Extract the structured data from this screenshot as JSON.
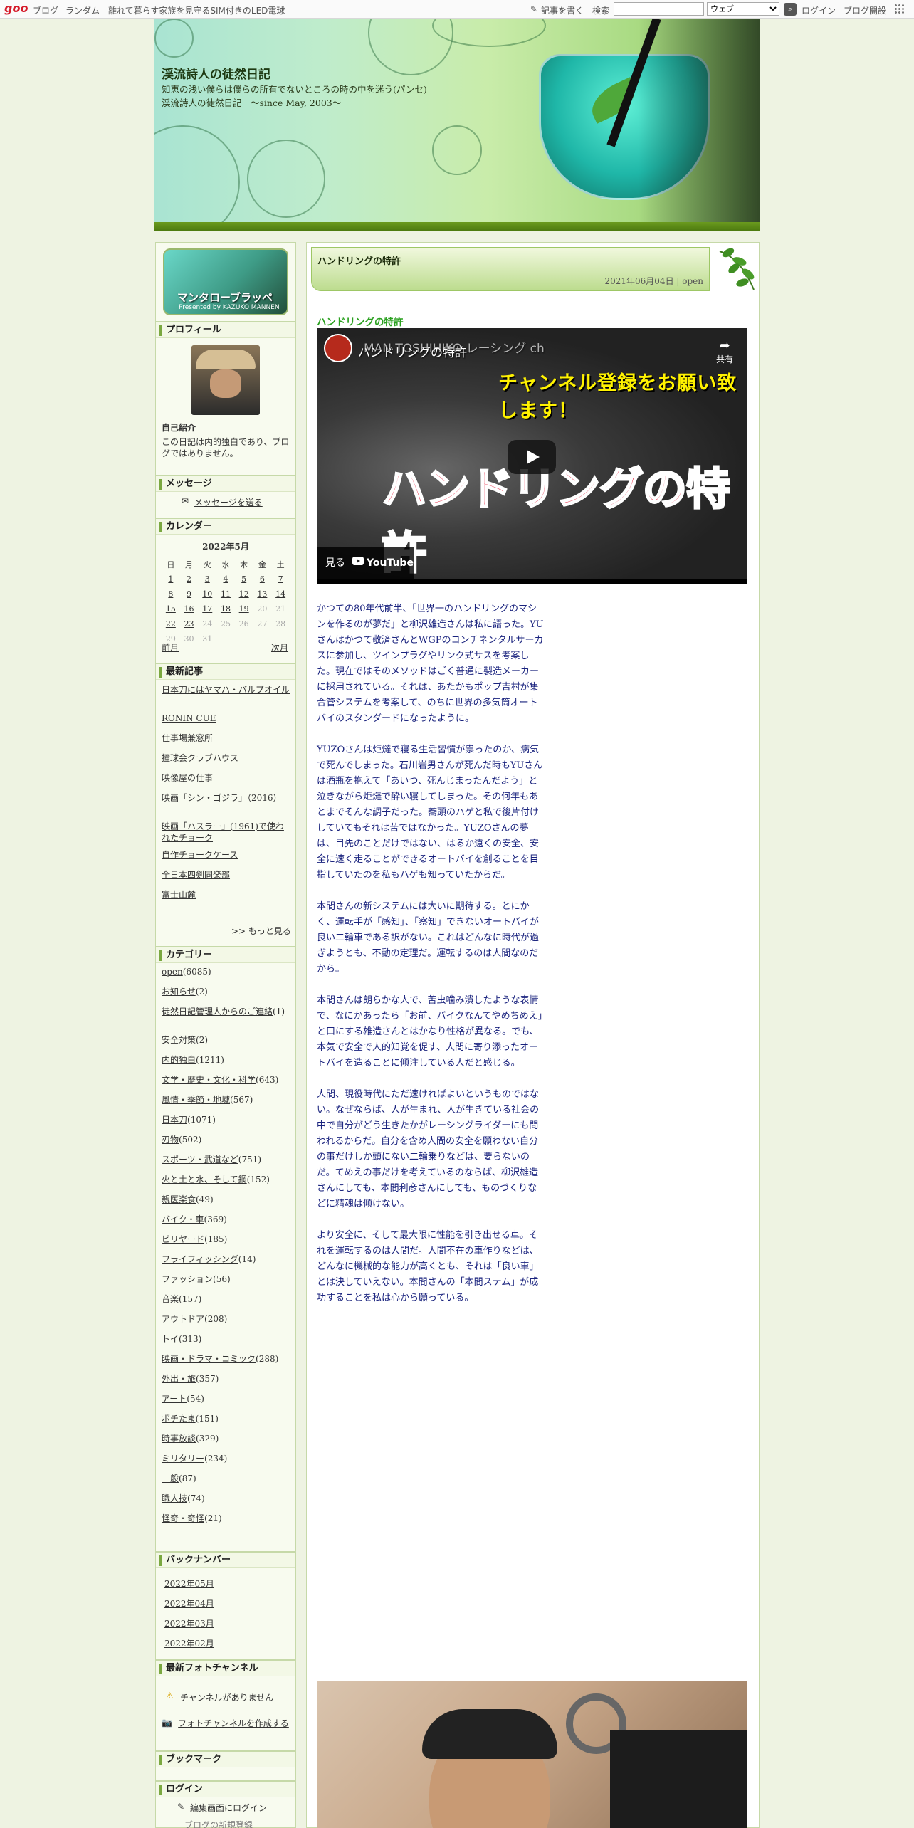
{
  "toolbar": {
    "logo": "goo",
    "blog_link": "ブログ",
    "random_link": "ランダム",
    "ad_text": "離れて暮らす家族を見守るSIM付きのLED電球",
    "write_link": "記事を書く",
    "search_label": "検索",
    "search_value": "",
    "search_scope": "ウェブ",
    "login_link": "ログイン",
    "open_blog_link": "ブログ開設"
  },
  "header": {
    "title": "渓流詩人の徒然日記",
    "description": "知恵の浅い僕らは僕らの所有でないところの時の中を迷う(パンセ)　渓流詩人の徒然日記　～since May, 2003～"
  },
  "sidebar": {
    "banner_title": "マンタローブラッペ",
    "banner_sub": "Presented by KAZUKO MANNEN",
    "profile": {
      "heading": "プロフィール",
      "intro_heading": "自己紹介",
      "intro_text": "この日記は内的独白であり、ブログではありません。"
    },
    "message": {
      "heading": "メッセージ",
      "link": "メッセージを送る"
    },
    "calendar": {
      "heading": "カレンダー",
      "month": "2022年5月",
      "weekdays": [
        "日",
        "月",
        "火",
        "水",
        "木",
        "金",
        "土"
      ],
      "weeks": [
        [
          "1",
          "2",
          "3",
          "4",
          "5",
          "6",
          "7"
        ],
        [
          "8",
          "9",
          "10",
          "11",
          "12",
          "13",
          "14"
        ],
        [
          "15",
          "16",
          "17",
          "18",
          "19",
          "20",
          "21"
        ],
        [
          "22",
          "23",
          "24",
          "25",
          "26",
          "27",
          "28"
        ],
        [
          "29",
          "30",
          "31",
          "",
          "",
          "",
          ""
        ]
      ],
      "prev": "前月",
      "next": "次月"
    },
    "recent": {
      "heading": "最新記事",
      "items": [
        "日本刀にはヤマハ・バルブオイル",
        "RONIN CUE",
        "仕事場兼窓所",
        "撞球会クラブハウス",
        "映像屋の仕事",
        "映画「シン・ゴジラ」（2016）",
        "映画「ハスラー」(1961)で使われたチョーク",
        "自作チョークケース",
        "全日本四剣同楽部",
        "富士山麓"
      ],
      "more": ">> もっと見る"
    },
    "categories": {
      "heading": "カテゴリー",
      "items": [
        {
          "name": "open",
          "count": "(6085)"
        },
        {
          "name": "お知らせ",
          "count": "(2)"
        },
        {
          "name": "徒然日記管理人からのご連絡",
          "count": "(1)"
        },
        {
          "name": "安全対策",
          "count": "(2)"
        },
        {
          "name": "内的独白",
          "count": "(1211)"
        },
        {
          "name": "文学・歴史・文化・科学",
          "count": "(643)"
        },
        {
          "name": "風情・季節・地域",
          "count": "(567)"
        },
        {
          "name": "日本刀",
          "count": "(1071)"
        },
        {
          "name": "刃物",
          "count": "(502)"
        },
        {
          "name": "スポーツ・武道など",
          "count": "(751)"
        },
        {
          "name": "火と土と水、そして鋼",
          "count": "(152)"
        },
        {
          "name": "親医楽食",
          "count": "(49)"
        },
        {
          "name": "バイク・車",
          "count": "(369)"
        },
        {
          "name": "ビリヤード",
          "count": "(185)"
        },
        {
          "name": "フライフィッシング",
          "count": "(14)"
        },
        {
          "name": "ファッション",
          "count": "(56)"
        },
        {
          "name": "音楽",
          "count": "(157)"
        },
        {
          "name": "アウトドア",
          "count": "(208)"
        },
        {
          "name": "トイ",
          "count": "(313)"
        },
        {
          "name": "映画・ドラマ・コミック",
          "count": "(288)"
        },
        {
          "name": "外出・旅",
          "count": "(357)"
        },
        {
          "name": "アート",
          "count": "(54)"
        },
        {
          "name": "ポチたま",
          "count": "(151)"
        },
        {
          "name": "時事放談",
          "count": "(329)"
        },
        {
          "name": "ミリタリー",
          "count": "(234)"
        },
        {
          "name": "一般",
          "count": "(87)"
        },
        {
          "name": "職人技",
          "count": "(74)"
        },
        {
          "name": "怪奇・奇怪",
          "count": "(21)"
        }
      ]
    },
    "backnumber": {
      "heading": "バックナンバー",
      "items": [
        "2022年05月",
        "2022年04月",
        "2022年03月",
        "2022年02月"
      ]
    },
    "photo_channel": {
      "heading": "最新フォトチャンネル",
      "empty": "チャンネルがありません",
      "create": "フォトチャンネルを作成する"
    },
    "bookmark": {
      "heading": "ブックマーク"
    },
    "login": {
      "heading": "ログイン",
      "link": "編集画面にログイン",
      "more": "ブログの新規登録"
    }
  },
  "entry": {
    "title": "ハンドリングの特許",
    "date": "2021年06月04日",
    "category": "open",
    "heading": "ハンドリングの特許",
    "video": {
      "title": "ハンドリングの特許",
      "channel_text": "MAN TOSHIHIKO レーシング ch",
      "subscribe_text": "チャンネル登録をお願い致します！",
      "big_text": "ハンドリングの特許",
      "share": "共有",
      "watch": "見る",
      "youtube": "YouTube"
    },
    "paragraphs": [
      "かつての80年代前半、「世界一のハンドリングのマシンを作るのが夢だ」と柳沢雄造さんは私に語った。YUさんはかつて敬済さんとWGPのコンチネンタルサーカスに参加し、ツインプラグやリンク式サスを考案した。現在ではそのメソッドはごく普通に製造メーカーに採用されている。それは、あたかもポップ吉村が集合管システムを考案して、のちに世界の多気筒オートバイのスタンダードになったように。",
      "YUZOさんは炬燵で寝る生活習慣が祟ったのか、病気で死んでしまった。石川岩男さんが死んだ時もYUさんは酒瓶を抱えて「あいつ、死んじまったんだよう」と泣きながら炬燵で酔い寝してしまった。その何年もあとまでそんな調子だった。蕎頭のハゲと私で後片付けしていてもそれは苦ではなかった。YUZOさんの夢は、目先のことだけではない、はるか遠くの安全、安全に速く走ることができるオートバイを創ることを目指していたのを私もハゲも知っていたからだ。",
      "本間さんの新システムには大いに期待する。とにかく、運転手が「感知」、「察知」できないオートバイが良い二輪車である訳がない。これはどんなに時代が過ぎようとも、不動の定理だ。運転するのは人間なのだから。",
      "本間さんは朗らかな人で、苦虫噛み潰したような表情で、なにかあったら「お前、バイクなんてやめちめえ」と口にする雄造さんとはかなり性格が異なる。でも、本気で安全で人的知覚を促す、人間に寄り添ったオートバイを造ることに傾注している人だと感じる。",
      "人間、現役時代にただ速ければよいというものではない。なぜならば、人が生まれ、人が生きている社会の中で自分がどう生きたかがレーシングライダーにも問われるからだ。自分を含め人間の安全を願わない自分の事だけしか頭にない二輪乗りなどは、要らないのだ。てめえの事だけを考えているのならば、柳沢雄造さんにしても、本間利彦さんにしても、ものづくりなどに精魂は傾けない。",
      "より安全に、そして最大限に性能を引き出せる車。それを運転するのは人間だ。人間不在の車作りなどは、どんなに機械的な能力が高くとも、それは「良い車」とは決していえない。本間さんの「本間ステム」が成功することを私は心から願っている。"
    ]
  },
  "colors": {
    "accent_green": "#29a01e",
    "body_text": "#1a237e",
    "header_bar": "#5e8c1a"
  }
}
